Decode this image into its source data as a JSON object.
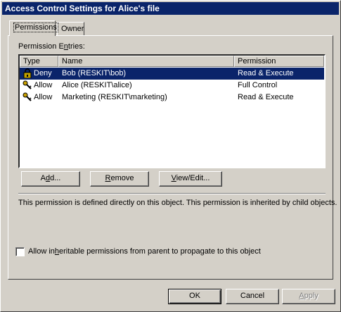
{
  "window": {
    "title": "Access Control Settings for Alice's file"
  },
  "tabs": [
    {
      "label": "Permissions",
      "active": true
    },
    {
      "label": "Owner",
      "active": false
    }
  ],
  "permissions": {
    "entries_label_pre": "Permission E",
    "entries_label_ul": "n",
    "entries_label_post": "tries:",
    "columns": {
      "type": "Type",
      "name": "Name",
      "permission": "Permission"
    },
    "rows": [
      {
        "icon": "lock-icon",
        "type": "Deny",
        "name": "Bob (RESKIT\\bob)",
        "permission": "Read & Execute",
        "selected": true
      },
      {
        "icon": "keys-icon",
        "type": "Allow",
        "name": "Alice (RESKIT\\alice)",
        "permission": "Full Control",
        "selected": false
      },
      {
        "icon": "keys-icon",
        "type": "Allow",
        "name": "Marketing (RESKIT\\marketing)",
        "permission": "Read & Execute",
        "selected": false
      }
    ],
    "buttons": {
      "add_pre": "A",
      "add_ul": "d",
      "add_post": "d...",
      "remove_ul": "R",
      "remove_post": "emove",
      "view_pre": "",
      "view_ul": "V",
      "view_post": "iew/Edit..."
    },
    "description": "This permission is defined directly on this object. This permission is inherited by child objects.",
    "inherit_checkbox": {
      "label_pre": "Allow in",
      "label_ul": "h",
      "label_post": "eritable permissions from parent to propagate to this object",
      "checked": false
    }
  },
  "footer": {
    "ok": "OK",
    "cancel": "Cancel",
    "apply_ul": "A",
    "apply_post": "pply"
  },
  "colors": {
    "title_bar": "#0a246a",
    "face": "#d4d0c8",
    "selection": "#0a246a"
  }
}
